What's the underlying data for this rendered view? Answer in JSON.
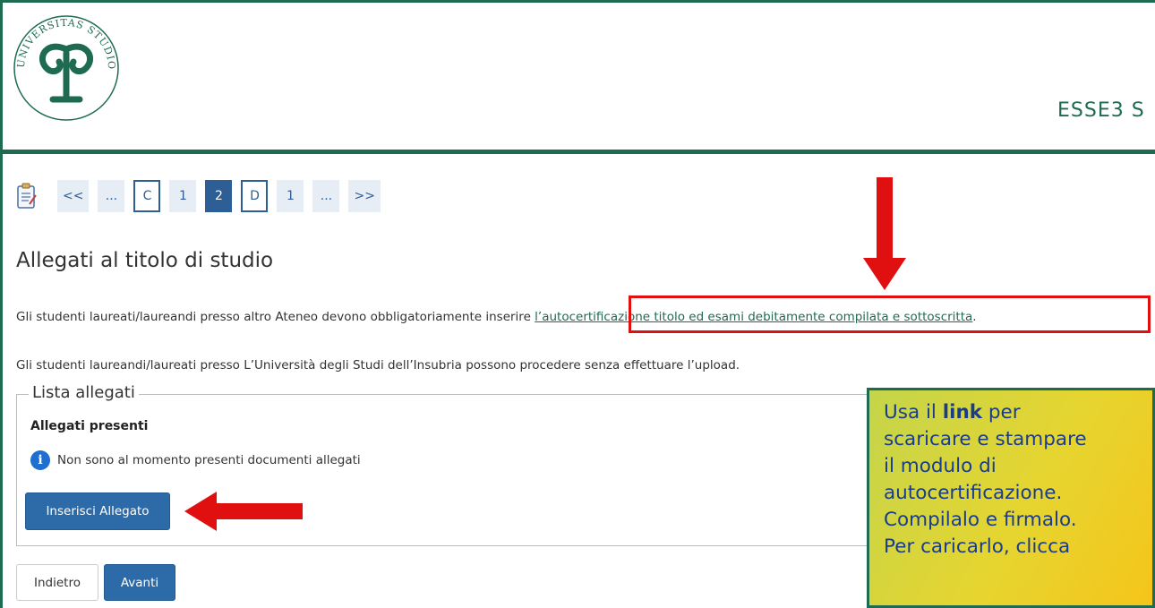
{
  "header": {
    "logo_text": "UNIVERSITAS STUDIORUM INSUBRIAE",
    "app_name": "ESSE3 S"
  },
  "stepper": {
    "steps": [
      "<<",
      "...",
      "C",
      "1",
      "2",
      "D",
      "1",
      "...",
      ">>"
    ]
  },
  "page": {
    "title": "Allegati al titolo di studio",
    "para1_prefix": "Gli studenti laureati/laureandi presso altro Ateneo devono obbligatoriamente inserire ",
    "para1_link": "l’autocertificazione titolo ed esami debitamente compilata e sottoscritta",
    "para1_suffix": ".",
    "para2": "Gli studenti laureandi/laureati presso L’Università degli Studi dell’Insubria possono procedere senza effettuare l’upload."
  },
  "attachments": {
    "legend": "Lista allegati",
    "subheading": "Allegati presenti",
    "empty_message": "Non sono al momento presenti documenti allegati",
    "insert_button": "Inserisci Allegato"
  },
  "navigation": {
    "back_label": "Indietro",
    "next_label": "Avanti"
  },
  "callout": {
    "line1_pre": "Usa il ",
    "line1_bold": "link",
    "line1_post": " per",
    "line2": "scaricare e stampare",
    "line3": "il modulo di",
    "line4": "autocertificazione.",
    "line5": "Compilalo e firmalo.",
    "line6": "Per caricarlo, clicca"
  },
  "colors": {
    "brand_green": "#1e6b52",
    "primary_blue": "#2d6aa8",
    "annotation_red": "#e01010"
  }
}
